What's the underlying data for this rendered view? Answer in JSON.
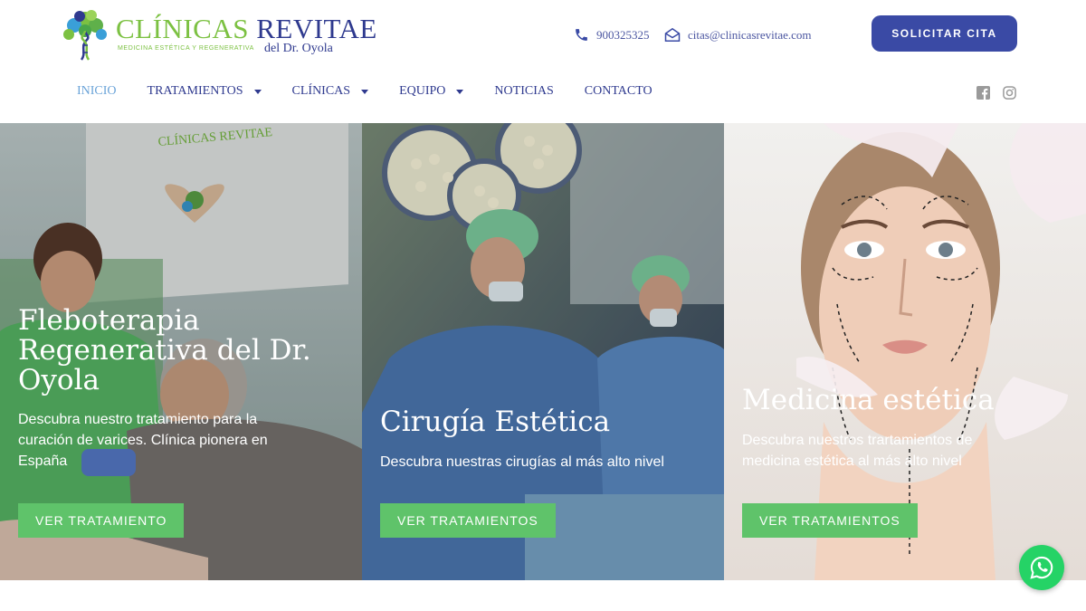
{
  "header": {
    "logo": {
      "title_green": "CLÍNICAS",
      "title_blue": "REVITAE",
      "subtitle": "MEDICINA ESTÉTICA Y REGENERATIVA",
      "byline": "del Dr. Oyola"
    },
    "phone": "900325325",
    "email": "citas@clinicasrevitae.com",
    "cta_label": "SOLICITAR CITA"
  },
  "nav": {
    "items": [
      {
        "label": "INICIO",
        "active": true,
        "dropdown": false
      },
      {
        "label": "TRATAMIENTOS",
        "active": false,
        "dropdown": true
      },
      {
        "label": "CLÍNICAS",
        "active": false,
        "dropdown": true
      },
      {
        "label": "EQUIPO",
        "active": false,
        "dropdown": true
      },
      {
        "label": "NOTICIAS",
        "active": false,
        "dropdown": false
      },
      {
        "label": "CONTACTO",
        "active": false,
        "dropdown": false
      }
    ],
    "social": [
      "facebook-icon",
      "instagram-icon"
    ]
  },
  "panels": [
    {
      "title": "Fleboterapia Regenerativa del Dr. Oyola",
      "description": "Descubra nuestro tratamiento para la curación de varices. Clínica pionera en España",
      "button": "VER TRATAMIENTO"
    },
    {
      "title": "Cirugía Estética",
      "description": "Descubra nuestras cirugías al más alto nivel",
      "button": "VER TRATAMIENTOS"
    },
    {
      "title": "Medicina estética",
      "description": "Descubra nuestros trartamientos de medicina estética al más alto nivel",
      "button": "VER TRATAMIENTOS"
    }
  ],
  "colors": {
    "brand_blue": "#3a4aa5",
    "brand_green": "#7cc142",
    "button_green": "#5fc36a",
    "whatsapp": "#25d366"
  }
}
